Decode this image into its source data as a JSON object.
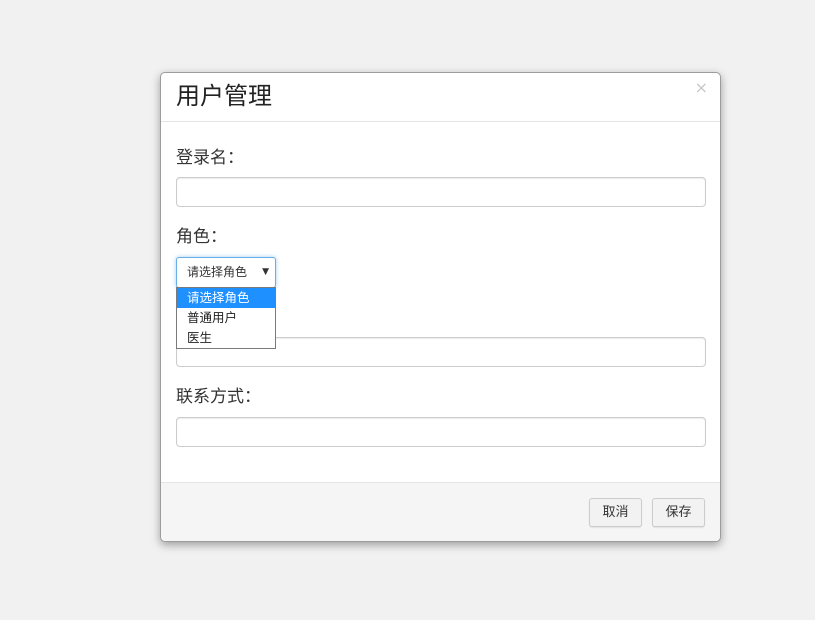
{
  "dialog": {
    "title": "用户管理",
    "close_symbol": "×"
  },
  "form": {
    "login_name": {
      "label": "登录名：",
      "value": ""
    },
    "role": {
      "label": "角色：",
      "selected": "请选择角色",
      "options": [
        "请选择角色",
        "普通用户",
        "医生"
      ],
      "highlighted_index": 0
    },
    "hidden_field": {
      "value": ""
    },
    "contact": {
      "label": "联系方式：",
      "value": ""
    }
  },
  "footer": {
    "cancel_label": "取消",
    "save_label": "保存"
  },
  "colors": {
    "background": "#f1f1f1",
    "highlight": "#1e90ff",
    "focus_border": "#66afe9"
  }
}
